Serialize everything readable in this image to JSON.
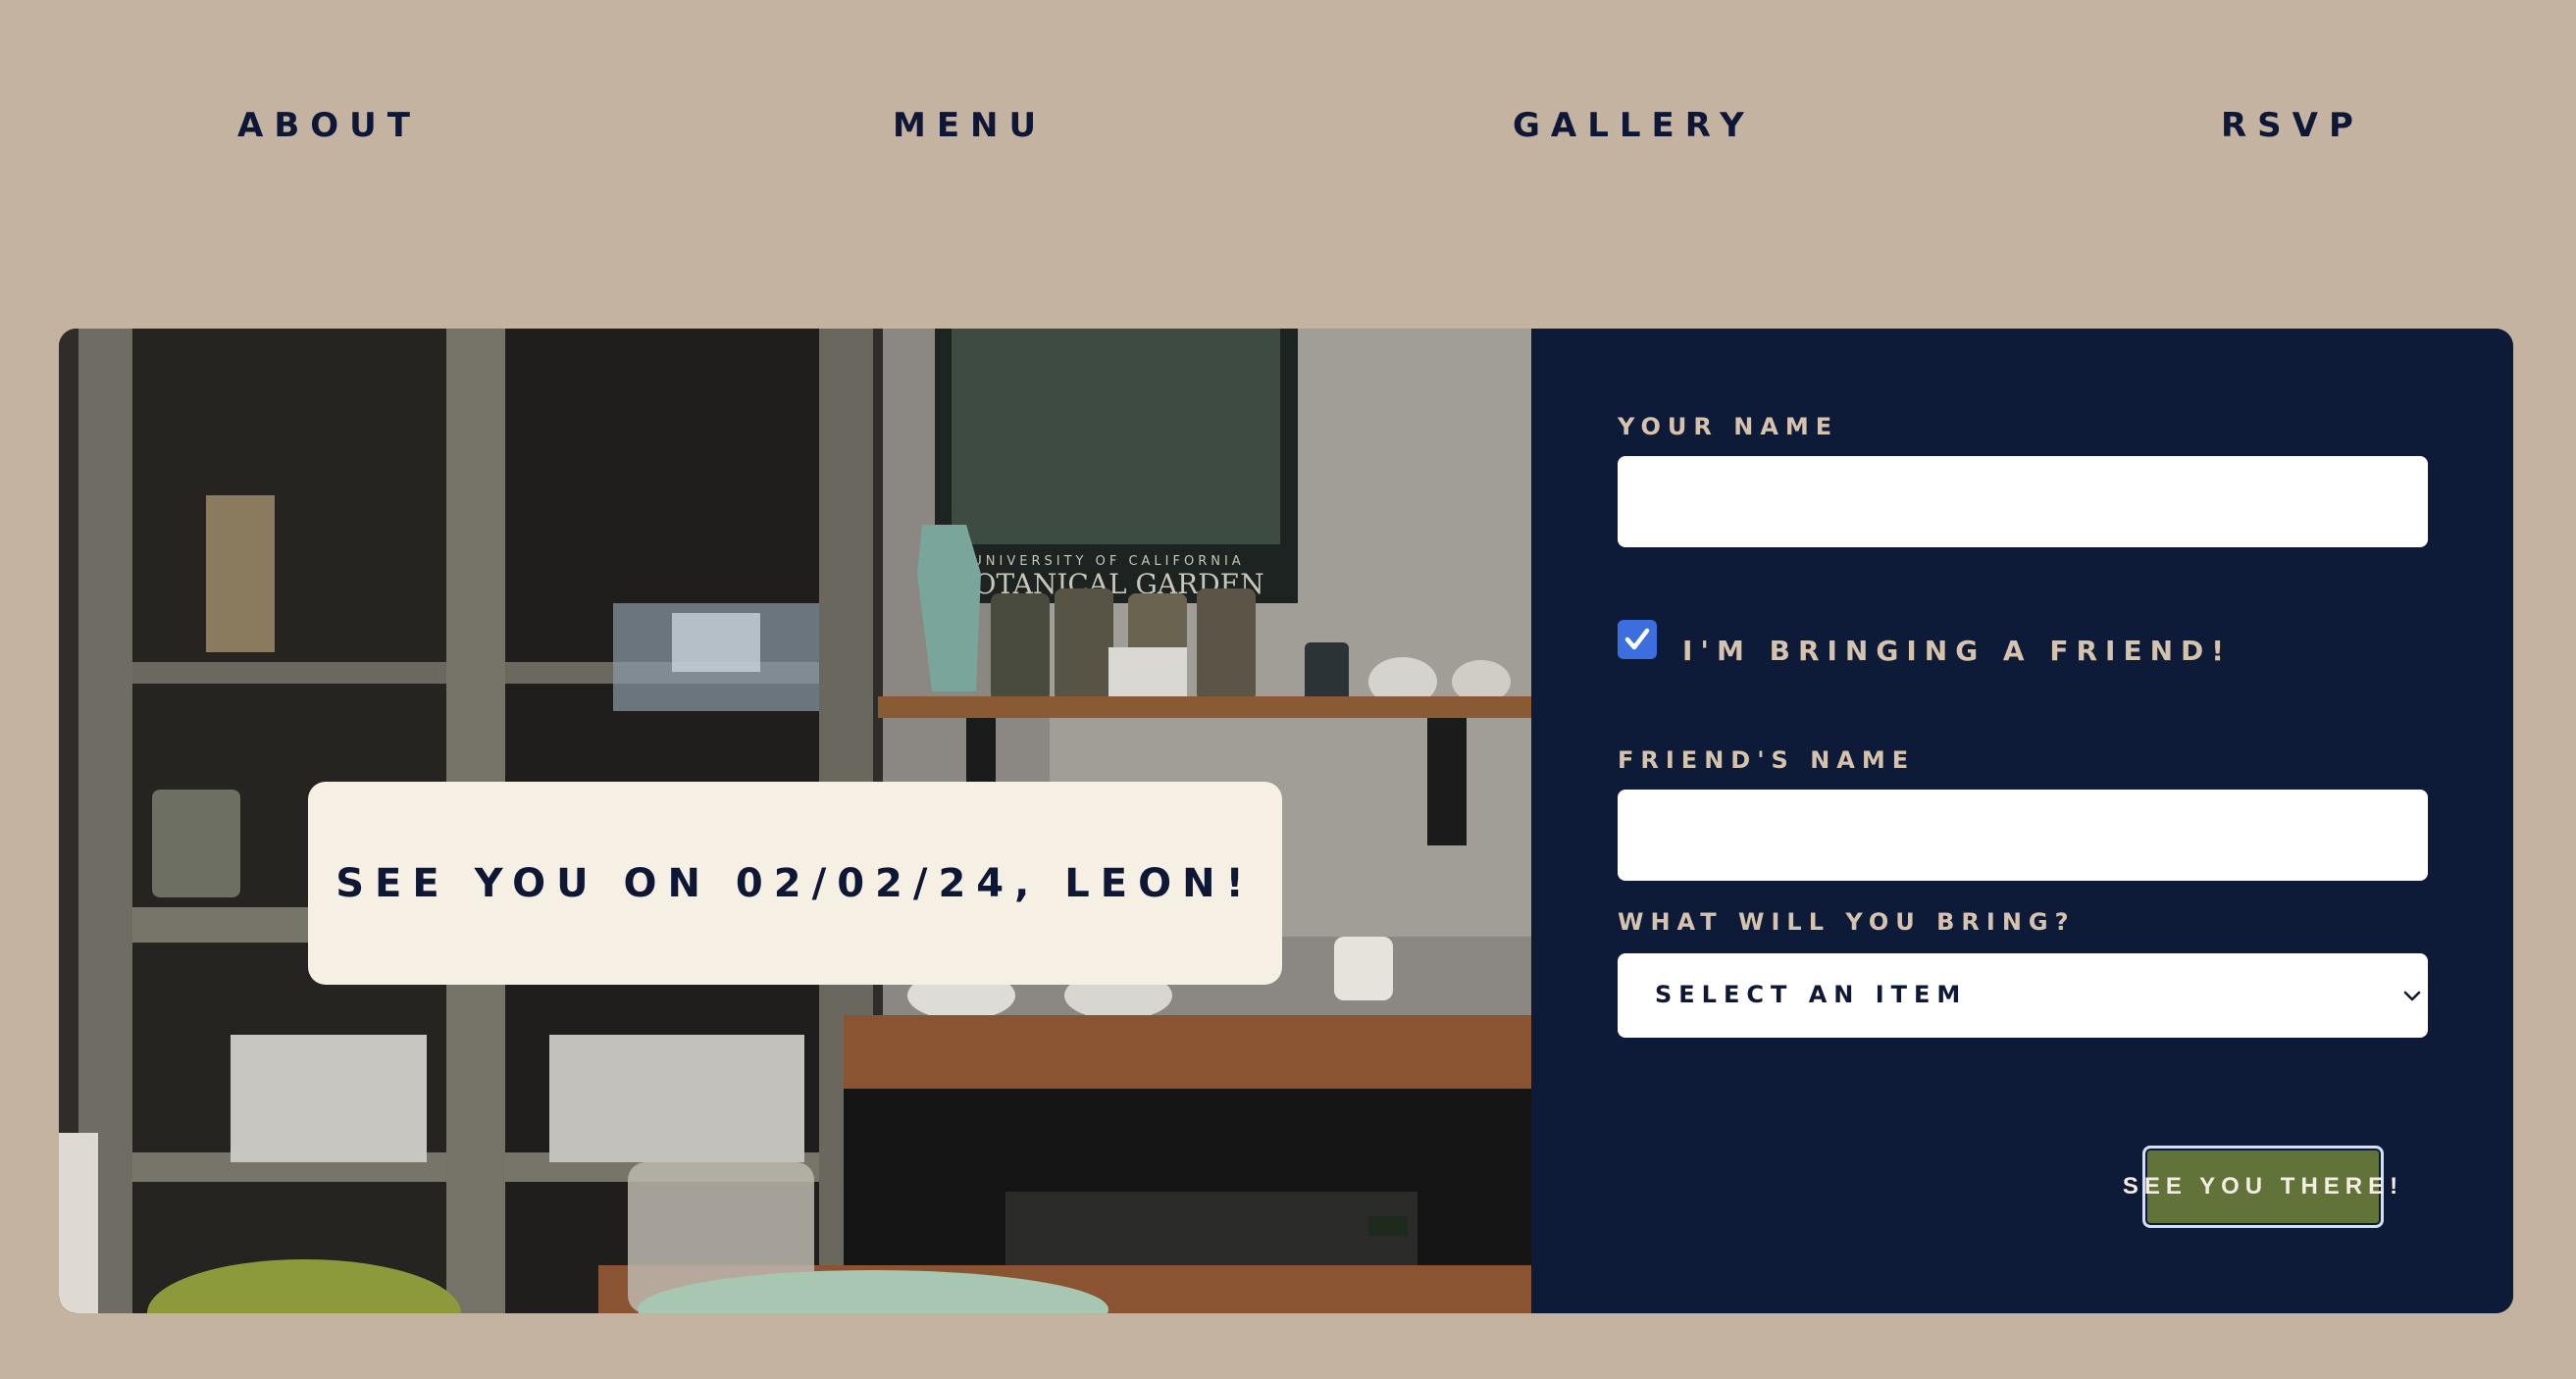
{
  "nav": {
    "items": [
      {
        "label": "ABOUT"
      },
      {
        "label": "MENU"
      },
      {
        "label": "GALLERY"
      },
      {
        "label": "RSVP"
      }
    ]
  },
  "hero": {
    "banner_text": "SEE YOU ON 02/02/24, LEON!",
    "poster_line1": "UNIVERSITY OF CALIFORNIA",
    "poster_line2": "BOTANICAL GARDEN"
  },
  "form": {
    "name_label": "YOUR NAME",
    "name_value": "",
    "friend_checkbox_label": "I'M BRINGING A FRIEND!",
    "friend_checked": true,
    "friend_name_label": "FRIEND'S NAME",
    "friend_name_value": "",
    "bring_label": "WHAT WILL YOU BRING?",
    "bring_selected": "SELECT AN ITEM",
    "submit_label": "SEE YOU THERE!"
  },
  "colors": {
    "page_bg": "#c5b3a2",
    "navy": "#0e1836",
    "form_bg": "#0d1a38",
    "label_tan": "#d6c3ae",
    "banner_bg": "#f6efe4",
    "button_green": "#62733a",
    "checkbox_blue": "#3d6ee0"
  },
  "icons": {
    "checkbox": "checkmark-icon",
    "select": "chevron-down-icon"
  }
}
